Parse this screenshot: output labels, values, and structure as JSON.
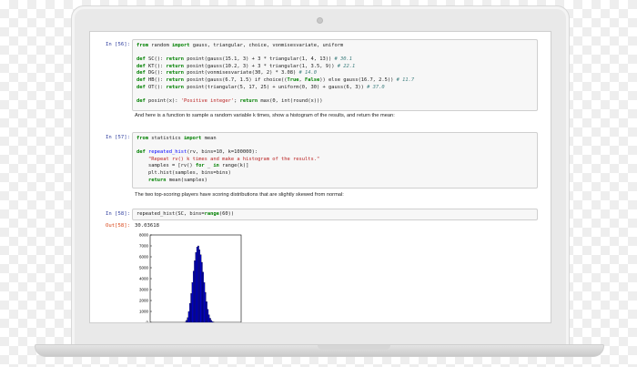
{
  "cells": {
    "c56": {
      "prompt": "In [56]:",
      "lines": [
        [
          [
            "kw",
            "from"
          ],
          [
            "t",
            " "
          ],
          [
            "t",
            "random"
          ],
          [
            "t",
            " "
          ],
          [
            "kw",
            "import"
          ],
          [
            "t",
            " gauss, triangular, choice, vonmisesvariate, uniform"
          ]
        ],
        [],
        [
          [
            "kw",
            "def"
          ],
          [
            "t",
            " SC(): "
          ],
          [
            "kw",
            "return"
          ],
          [
            "t",
            " posint(gauss(15.1, 3) + 3 * triangular(1, 4, 13)) "
          ],
          [
            "cm",
            "# 30.1"
          ]
        ],
        [
          [
            "kw",
            "def"
          ],
          [
            "t",
            " KT(): "
          ],
          [
            "kw",
            "return"
          ],
          [
            "t",
            " posint(gauss(10.2, 3) + 3 * triangular(1, 3.5, 9)) "
          ],
          [
            "cm",
            "# 22.1"
          ]
        ],
        [
          [
            "kw",
            "def"
          ],
          [
            "t",
            " DG(): "
          ],
          [
            "kw",
            "return"
          ],
          [
            "t",
            " posint(vonmisesvariate(30, 2) * 3.08) "
          ],
          [
            "cm",
            "# 14.0"
          ]
        ],
        [
          [
            "kw",
            "def"
          ],
          [
            "t",
            " HB(): "
          ],
          [
            "kw",
            "return"
          ],
          [
            "t",
            " posint(gauss(6.7, 1.5) if choice(("
          ],
          [
            "kw",
            "True"
          ],
          [
            "t",
            ", "
          ],
          [
            "kw",
            "False"
          ],
          [
            "t",
            ")) else gauss(16.7, 2.5)) "
          ],
          [
            "cm",
            "# 11.7"
          ]
        ],
        [
          [
            "kw",
            "def"
          ],
          [
            "t",
            " OT(): "
          ],
          [
            "kw",
            "return"
          ],
          [
            "t",
            " posint(triangular(5, 17, 25) + uniform(0, 30) + gauss(6, 3)) "
          ],
          [
            "cm",
            "# 37.0"
          ]
        ],
        [],
        [
          [
            "kw",
            "def"
          ],
          [
            "t",
            " posint(x): "
          ],
          [
            "str",
            "'Positive integer'"
          ],
          [
            "t",
            "; "
          ],
          [
            "kw",
            "return"
          ],
          [
            "t",
            " max(0, int(round(x)))"
          ]
        ]
      ]
    },
    "md1": "And here is a function to sample a random variable k times, show a histogram of the results, and return the mean:",
    "c57": {
      "prompt": "In [57]:",
      "lines": [
        [
          [
            "kw",
            "from"
          ],
          [
            "t",
            " statistics "
          ],
          [
            "kw",
            "import"
          ],
          [
            "t",
            " mean"
          ]
        ],
        [],
        [
          [
            "kw",
            "def"
          ],
          [
            "t",
            " "
          ],
          [
            "fn",
            "repeated_hist"
          ],
          [
            "t",
            "(rv, bins=10, k=100000):"
          ]
        ],
        [
          [
            "t",
            "    "
          ],
          [
            "str",
            "\"Repeat rv() k times and make a histogram of the results.\""
          ]
        ],
        [
          [
            "t",
            "    samples = [rv() "
          ],
          [
            "kw",
            "for"
          ],
          [
            "t",
            " _ "
          ],
          [
            "kw",
            "in"
          ],
          [
            "t",
            " range(k)]"
          ]
        ],
        [
          [
            "t",
            "    plt.hist(samples, bins=bins)"
          ]
        ],
        [
          [
            "t",
            "    "
          ],
          [
            "kw",
            "return"
          ],
          [
            "t",
            " mean(samples)"
          ]
        ]
      ]
    },
    "md2": "The two top-scoring players have scoring distributions that are slightly skewed from normal:",
    "c58": {
      "prompt": "In [58]:",
      "out_prompt": "Out[58]:",
      "lines": [
        [
          [
            "t",
            "repeated_hist(SC, bins="
          ],
          [
            "kw",
            "range"
          ],
          [
            "t",
            "(60))"
          ]
        ]
      ],
      "output_value": "30.03618"
    }
  },
  "chart_data": {
    "type": "bar",
    "title": "",
    "xlabel": "",
    "ylabel": "",
    "ylim": [
      0,
      8000
    ],
    "yticks": [
      "0",
      "1000",
      "2000",
      "3000",
      "4000",
      "5000",
      "6000",
      "7000",
      "8000"
    ],
    "bar_color": "#0000cc",
    "values": [
      30,
      180,
      430,
      1000,
      1750,
      2650,
      3650,
      4700,
      5650,
      6400,
      6900,
      7000,
      6650,
      6200,
      5500,
      4600,
      3650,
      2750,
      1900,
      1200,
      700,
      380,
      180,
      80,
      30
    ]
  }
}
